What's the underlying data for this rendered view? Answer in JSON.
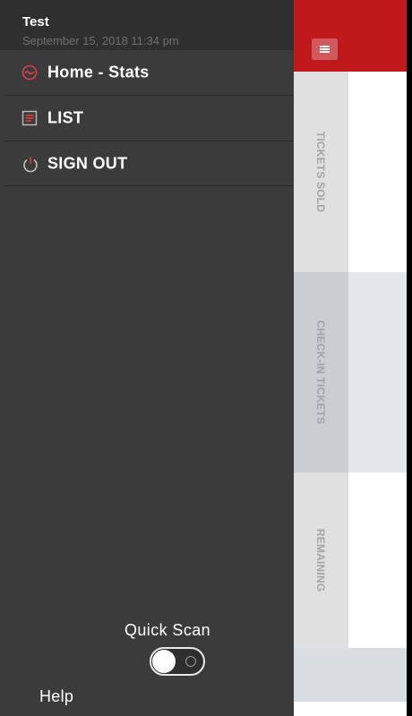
{
  "drawer": {
    "user_name": "Test",
    "datetime": "September 15, 2018 11:34 pm",
    "menu": [
      {
        "label": "Home - Stats",
        "icon": "stats-circle-icon"
      },
      {
        "label": "LIST",
        "icon": "list-icon"
      },
      {
        "label": "SIGN OUT",
        "icon": "power-icon"
      }
    ],
    "quick_scan_label": "Quick Scan",
    "quick_scan_on": false,
    "help_label": "Help"
  },
  "stats": {
    "tickets_sold_label": "TICKETS SOLD",
    "checkin_label": "CHECK-IN TICKETS",
    "remaining_label": "REMAINING"
  },
  "colors": {
    "accent": "#c0191c",
    "drawer_bg": "#3b3b3b",
    "drawer_header_bg": "#2f2f2f"
  }
}
